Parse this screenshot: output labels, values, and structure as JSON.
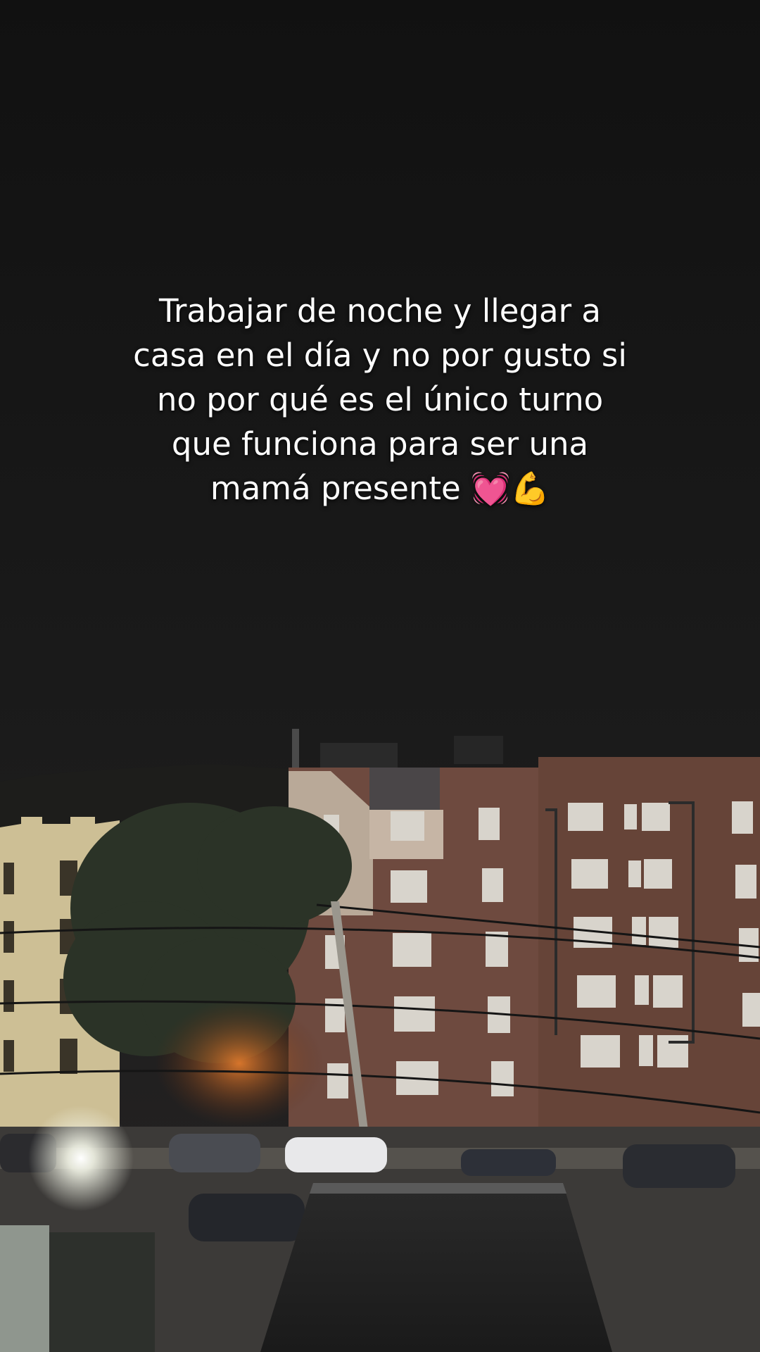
{
  "caption": {
    "lines": [
      "Trabajar de noche y llegar a",
      "casa en el día y no por gusto si",
      "no por qué es el único turno",
      "que funciona para ser una",
      "mamá presente 💓💪"
    ]
  },
  "scene": {
    "description_icons": [
      "night-sky",
      "apartment-buildings",
      "street-light",
      "parked-cars",
      "tree",
      "rooftop"
    ],
    "colors": {
      "sky": "#141414",
      "brick": "#6e4a3f",
      "beige_building": "#cdbf95",
      "street_glow": "#f5f5ea"
    }
  }
}
